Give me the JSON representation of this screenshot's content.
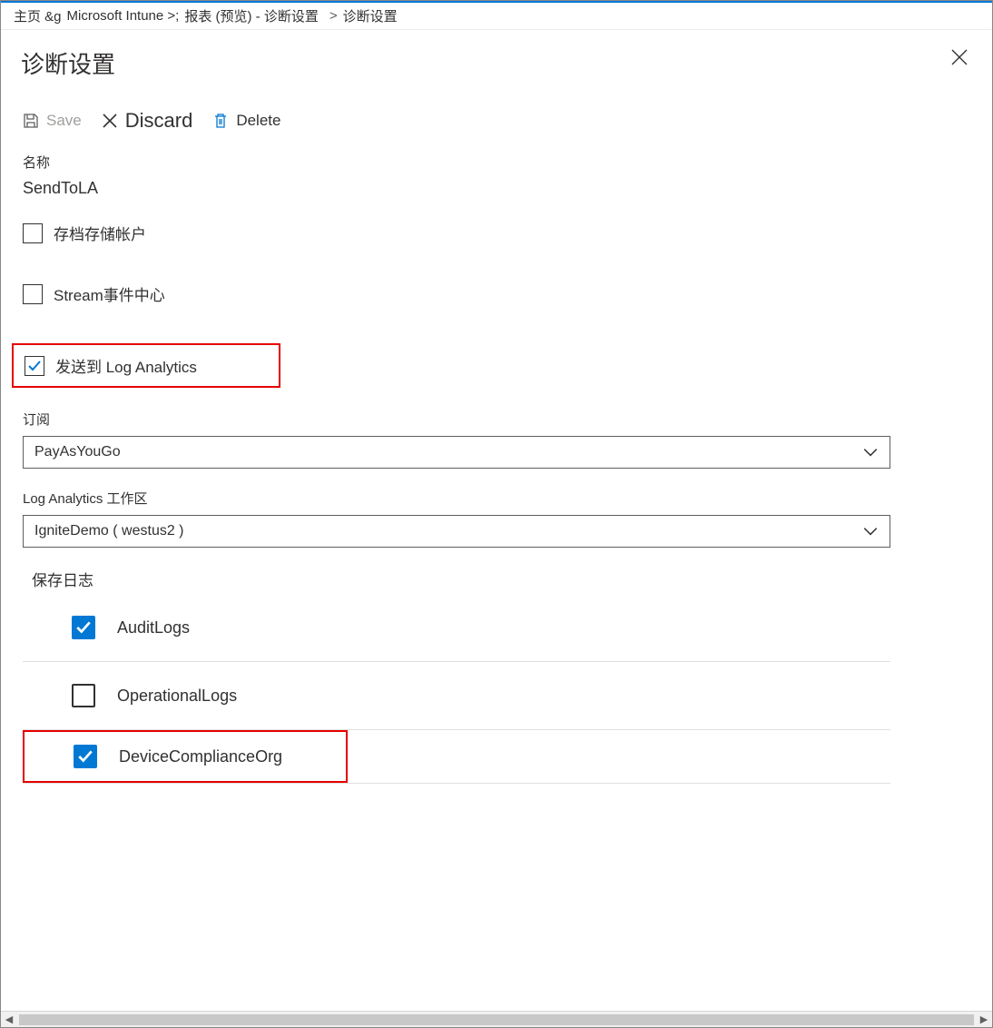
{
  "breadcrumb": {
    "item1": "主页 &g",
    "item2": "Microsoft Intune >;",
    "item3": "报表 (预览) - 诊断设置",
    "sep": ">",
    "item4": "诊断设置"
  },
  "panel": {
    "title": "诊断设置"
  },
  "toolbar": {
    "save_label": "Save",
    "discard_label": "Discard",
    "delete_label": "Delete"
  },
  "fields": {
    "name_label": "名称",
    "name_value": "SendToLA",
    "archive_label": "存档存储帐户",
    "stream_label": "Stream事件中心",
    "send_la_label": "发送到 Log Analytics"
  },
  "subscription": {
    "label": "订阅",
    "value": "PayAsYouGo"
  },
  "workspace": {
    "label": "Log Analytics 工作区",
    "value": "IgniteDemo ( westus2 )"
  },
  "logs": {
    "header": "保存日志",
    "items": [
      {
        "label": "AuditLogs",
        "checked": true
      },
      {
        "label": "OperationalLogs",
        "checked": false
      },
      {
        "label": "DeviceComplianceOrg",
        "checked": true
      }
    ]
  }
}
